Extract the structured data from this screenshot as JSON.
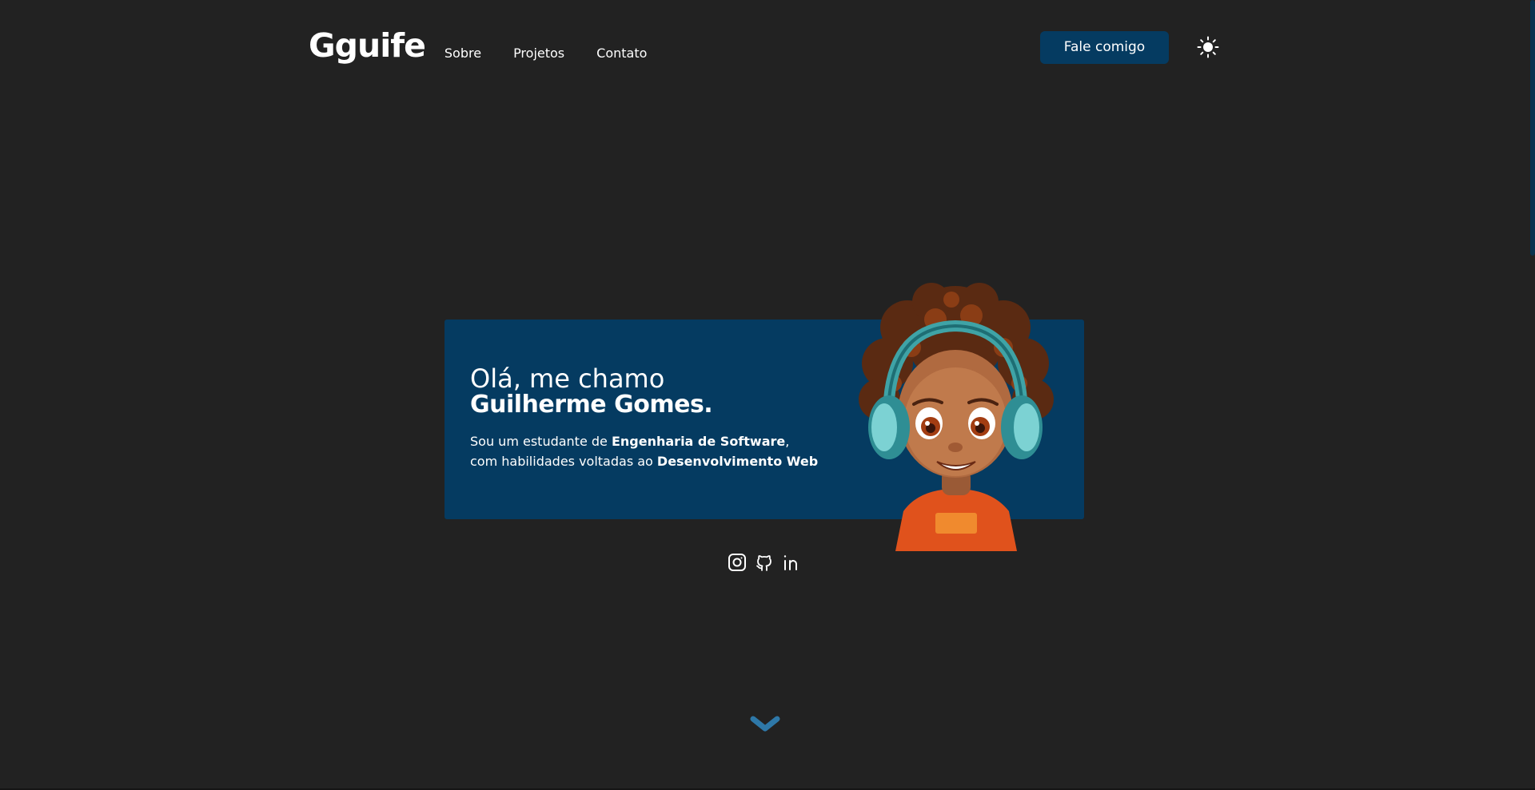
{
  "header": {
    "logo": "Gguife",
    "nav": [
      "Sobre",
      "Projetos",
      "Contato"
    ],
    "cta_label": "Fale comigo",
    "theme_icon": "sun-icon"
  },
  "hero": {
    "greeting": "Olá, me chamo",
    "name": "Guilherme Gomes.",
    "desc_line1_prefix": "Sou um estudante de ",
    "desc_line1_bold": "Engenharia de Software",
    "desc_line1_suffix": ",",
    "desc_line2_prefix": "com habilidades voltadas ao ",
    "desc_line2_bold": "Desenvolvimento Web"
  },
  "social": [
    "instagram-icon",
    "github-icon",
    "linkedin-icon"
  ],
  "colors": {
    "background": "#222222",
    "accent": "#053b61",
    "scroll_arrow": "#2e78a8"
  }
}
